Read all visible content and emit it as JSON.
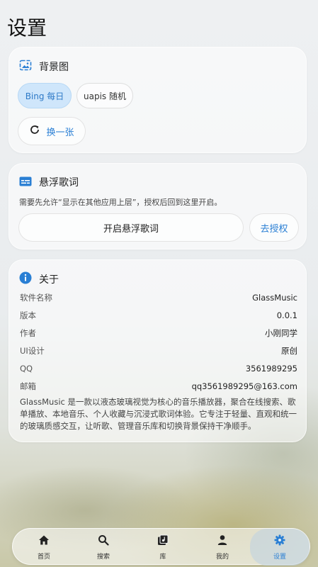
{
  "page": {
    "title": "设置"
  },
  "background_card": {
    "title": "背景图",
    "chips": [
      {
        "label": "Bing 每日",
        "selected": true
      },
      {
        "label": "uapis 随机",
        "selected": false
      }
    ],
    "refresh_label": "换一张"
  },
  "lyrics_card": {
    "title": "悬浮歌词",
    "description": "需要先允许“显示在其他应用上层”，授权后回到这里开启。",
    "enable_label": "开启悬浮歌词",
    "authorize_label": "去授权"
  },
  "about_card": {
    "title": "关于",
    "rows": [
      {
        "key": "软件名称",
        "value": "GlassMusic"
      },
      {
        "key": "版本",
        "value": "0.0.1"
      },
      {
        "key": "作者",
        "value": "小刚同学"
      },
      {
        "key": "UI设计",
        "value": "原创"
      },
      {
        "key": "QQ",
        "value": "3561989295"
      },
      {
        "key": "邮箱",
        "value": "qq3561989295@163.com"
      }
    ],
    "description_lines": [
      "GlassMusic 是一款以液态玻璃视觉为核心的音乐播放器，聚合在线搜索、歌",
      "单播放、本地音乐、个人收藏与沉浸式歌词体验。它专注于轻量、直观和统一",
      "的玻璃质感交互，让听歌、管理音乐库和切换背景保持干净顺手。"
    ]
  },
  "nav": {
    "items": [
      {
        "label": "首页",
        "icon": "home-icon"
      },
      {
        "label": "搜索",
        "icon": "search-icon"
      },
      {
        "label": "库",
        "icon": "library-icon"
      },
      {
        "label": "我的",
        "icon": "person-icon"
      },
      {
        "label": "设置",
        "icon": "gear-icon",
        "active": true
      }
    ]
  },
  "colors": {
    "accent": "#2a7fd4",
    "chip_selected_bg": "#cfe6fb"
  }
}
